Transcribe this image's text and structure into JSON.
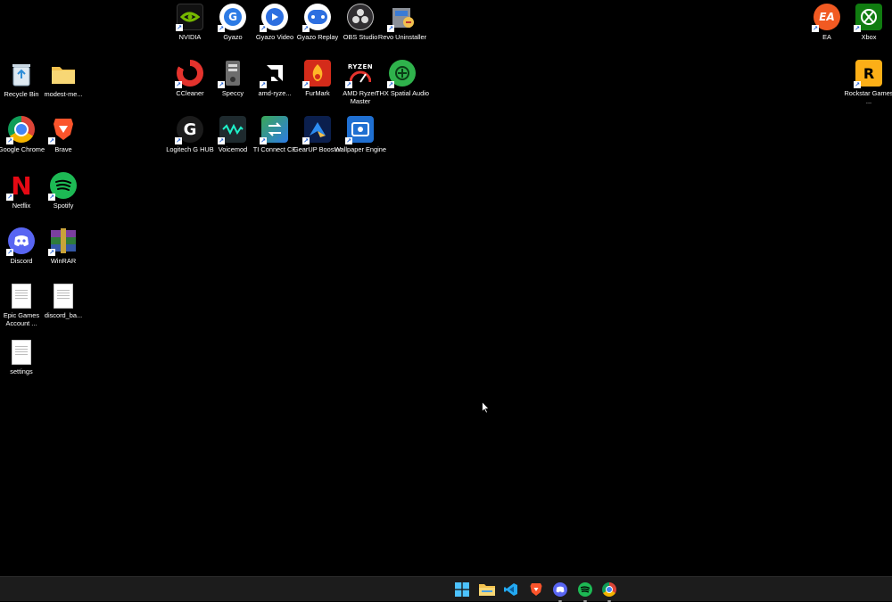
{
  "desktop_icons": [
    {
      "id": "recycle-bin",
      "label": "Recycle Bin",
      "icon": "recycle-bin-icon",
      "color": "#d7e7f1"
    },
    {
      "id": "modest-me",
      "label": "modest-me...",
      "icon": "folder-icon",
      "color": "#f2c14e"
    },
    {
      "id": "google-chrome",
      "label": "Google Chrome",
      "icon": "chrome-icon",
      "color": "#db4437"
    },
    {
      "id": "brave",
      "label": "Brave",
      "icon": "brave-icon",
      "color": "#fb542b"
    },
    {
      "id": "netflix",
      "label": "Netflix",
      "icon": "netflix-icon",
      "color": "#e50914"
    },
    {
      "id": "spotify",
      "label": "Spotify",
      "icon": "spotify-icon",
      "color": "#1db954"
    },
    {
      "id": "discord",
      "label": "Discord",
      "icon": "discord-icon",
      "color": "#5865f2"
    },
    {
      "id": "winrar",
      "label": "WinRAR",
      "icon": "winrar-icon",
      "color": "#7b3fa0"
    },
    {
      "id": "epic-games-account",
      "label": "Epic Games Account ...",
      "icon": "text-document-icon",
      "color": "#ffffff"
    },
    {
      "id": "discord-ba",
      "label": "discord_ba...",
      "icon": "text-document-icon",
      "color": "#ffffff"
    },
    {
      "id": "settings",
      "label": "settings",
      "icon": "text-document-icon",
      "color": "#ffffff"
    },
    {
      "id": "nvidia",
      "label": "NVIDIA",
      "icon": "nvidia-icon",
      "color": "#76b900"
    },
    {
      "id": "gyazo",
      "label": "Gyazo",
      "icon": "gyazo-icon",
      "color": "#2d7be5"
    },
    {
      "id": "gyazo-video",
      "label": "Gyazo Video",
      "icon": "gyazo-video-icon",
      "color": "#2d6fe0"
    },
    {
      "id": "gyazo-replay",
      "label": "Gyazo Replay",
      "icon": "gyazo-replay-icon",
      "color": "#2d6fe0"
    },
    {
      "id": "obs-studio",
      "label": "OBS Studio",
      "icon": "obs-icon",
      "color": "#302e31"
    },
    {
      "id": "revo-uninstaller",
      "label": "Revo Uninstaller",
      "icon": "revo-uninstaller-icon",
      "color": "#8a8f98"
    },
    {
      "id": "ccleaner",
      "label": "CCleaner",
      "icon": "ccleaner-icon",
      "color": "#e4332d"
    },
    {
      "id": "speccy",
      "label": "Speccy",
      "icon": "speccy-icon",
      "color": "#6d6d6d"
    },
    {
      "id": "amd-ryze",
      "label": "amd-ryze...",
      "icon": "amd-icon",
      "color": "#ffffff"
    },
    {
      "id": "furmark",
      "label": "FurMark",
      "icon": "furmark-icon",
      "color": "#d42b1a"
    },
    {
      "id": "amd-ryzen-master",
      "label": "AMD Ryzen Master",
      "icon": "ryzen-master-icon",
      "color": "#3a3a3a"
    },
    {
      "id": "thx-spatial-audio",
      "label": "THX Spatial Audio",
      "icon": "thx-icon",
      "color": "#2fb24c"
    },
    {
      "id": "logitech-g-hub",
      "label": "Logitech G HUB",
      "icon": "logitech-g-icon",
      "color": "#1b1b1b"
    },
    {
      "id": "voicemod",
      "label": "Voicemod",
      "icon": "voicemod-icon",
      "color": "#1e2a2e"
    },
    {
      "id": "ti-connect-ce",
      "label": "TI Connect CE",
      "icon": "ti-connect-icon",
      "color": "#3aa757"
    },
    {
      "id": "gearup-booster",
      "label": "GearUP Booster",
      "icon": "gearup-icon",
      "color": "#1e50c8"
    },
    {
      "id": "wallpaper-engine",
      "label": "Wallpaper Engine",
      "icon": "wallpaper-engine-icon",
      "color": "#1f6fd1"
    },
    {
      "id": "ea",
      "label": "EA",
      "icon": "ea-icon",
      "color": "#f15a22"
    },
    {
      "id": "xbox",
      "label": "Xbox",
      "icon": "xbox-icon",
      "color": "#107c10"
    },
    {
      "id": "rockstar-games",
      "label": "Rockstar Games ...",
      "icon": "rockstar-icon",
      "color": "#fcaf17"
    }
  ],
  "taskbar": {
    "items": [
      {
        "id": "start",
        "icon": "windows-start-icon",
        "color": "#4cc2ff"
      },
      {
        "id": "file-explorer",
        "icon": "file-explorer-icon",
        "color": "#f2c14e"
      },
      {
        "id": "vscode",
        "icon": "vscode-icon",
        "color": "#23a9f2"
      },
      {
        "id": "brave",
        "icon": "brave-icon",
        "color": "#fb542b"
      },
      {
        "id": "discord",
        "icon": "discord-icon",
        "color": "#5865f2"
      },
      {
        "id": "spotify",
        "icon": "spotify-icon",
        "color": "#1db954"
      },
      {
        "id": "chrome",
        "icon": "chrome-icon",
        "color": "#db4437"
      }
    ]
  }
}
